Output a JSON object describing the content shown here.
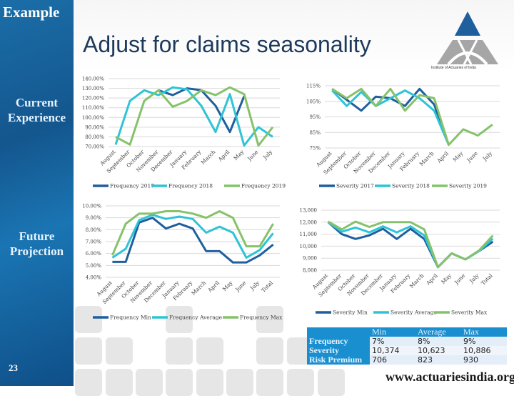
{
  "slide": {
    "tag": "Example",
    "title": "Adjust for claims seasonality",
    "section_current": [
      "Current",
      "Experience"
    ],
    "section_future": [
      "Future",
      "Projection"
    ],
    "page_number": "23",
    "logo_caption": "Institute of Actuaries of India",
    "website": "www.actuariesindia.org",
    "colors": {
      "dark_blue": "#1f5f9e",
      "teal": "#2ec4d6",
      "green": "#86c26a",
      "sidebar": "#14568e",
      "table_header": "#1a8fd0"
    }
  },
  "chart_data": [
    {
      "id": "frequency-current",
      "type": "line",
      "title": "",
      "categories": [
        "August",
        "September",
        "October",
        "November",
        "December",
        "January",
        "February",
        "March",
        "April",
        "May",
        "June",
        "July"
      ],
      "ylim": [
        70,
        140
      ],
      "yticks": [
        70,
        80,
        90,
        100,
        110,
        120,
        130,
        140
      ],
      "ytick_format": "pct2",
      "grid": true,
      "legend": "bottom",
      "series": [
        {
          "name": "Frequency 2017",
          "color": "#1f5f9e",
          "values": [
            null,
            null,
            null,
            128,
            123,
            130,
            128,
            112,
            85,
            122,
            null,
            null
          ]
        },
        {
          "name": "Frequency 2018",
          "color": "#2ec4d6",
          "values": [
            72,
            117,
            128,
            123,
            131,
            129,
            112,
            85,
            124,
            71,
            90,
            80
          ]
        },
        {
          "name": "Frequency 2019",
          "color": "#86c26a",
          "values": [
            80,
            72,
            117,
            128,
            111,
            117,
            128,
            123,
            131,
            124,
            71,
            90
          ]
        }
      ]
    },
    {
      "id": "severity-current",
      "type": "line",
      "title": "",
      "categories": [
        "August",
        "September",
        "October",
        "November",
        "December",
        "January",
        "February",
        "March",
        "April",
        "May",
        "June",
        "July"
      ],
      "ylim": [
        75,
        115
      ],
      "yticks": [
        75,
        85,
        95,
        105,
        115
      ],
      "ytick_format": "pct0",
      "grid": true,
      "legend": "bottom",
      "series": [
        {
          "name": "Severity 2017",
          "color": "#1f5f9e",
          "values": [
            113,
            106,
            99,
            108,
            107,
            102,
            113,
            103,
            77,
            null,
            null,
            null
          ]
        },
        {
          "name": "Severity 2018",
          "color": "#2ec4d6",
          "values": [
            112,
            102,
            111,
            102,
            107,
            112,
            107,
            99,
            77,
            null,
            null,
            null
          ]
        },
        {
          "name": "Severity 2019",
          "color": "#86c26a",
          "values": [
            113,
            107,
            113,
            102,
            113,
            99,
            109,
            107,
            77,
            87,
            83,
            90
          ]
        }
      ]
    },
    {
      "id": "frequency-projection",
      "type": "line",
      "title": "",
      "categories": [
        "August",
        "September",
        "October",
        "November",
        "December",
        "January",
        "February",
        "March",
        "April",
        "May",
        "June",
        "July",
        "Total"
      ],
      "ylim": [
        4,
        10
      ],
      "yticks": [
        4,
        5,
        6,
        7,
        8,
        9,
        10
      ],
      "ytick_format": "pct2",
      "grid": true,
      "legend": "bottom",
      "series": [
        {
          "name": "Frequency Min",
          "color": "#1f5f9e",
          "values": [
            5.3,
            5.3,
            8.6,
            9.0,
            8.1,
            8.5,
            8.1,
            6.2,
            6.2,
            5.25,
            5.25,
            5.85,
            6.75
          ]
        },
        {
          "name": "Frequency Average",
          "color": "#2ec4d6",
          "values": [
            5.65,
            6.4,
            8.8,
            9.25,
            8.9,
            9.1,
            8.9,
            7.75,
            8.25,
            7.75,
            5.65,
            6.3,
            7.7
          ]
        },
        {
          "name": "Frequency Max",
          "color": "#86c26a",
          "values": [
            5.85,
            8.5,
            9.35,
            9.35,
            9.55,
            9.55,
            9.35,
            9.0,
            9.55,
            9.0,
            6.6,
            6.6,
            8.5
          ]
        }
      ]
    },
    {
      "id": "severity-projection",
      "type": "line",
      "title": "",
      "categories": [
        "August",
        "September",
        "October",
        "November",
        "December",
        "January",
        "February",
        "March",
        "April",
        "May",
        "June",
        "July",
        "Total"
      ],
      "ylim": [
        8000,
        13000
      ],
      "yticks": [
        8000,
        9000,
        10000,
        11000,
        12000,
        13000
      ],
      "ytick_format": "num",
      "grid": true,
      "legend": "bottom",
      "series": [
        {
          "name": "Severity Min",
          "color": "#1f5f9e",
          "values": [
            12000,
            11000,
            10600,
            10900,
            11450,
            10600,
            11450,
            10600,
            8250,
            9400,
            8900,
            9600,
            10374
          ]
        },
        {
          "name": "Severity Average",
          "color": "#2ec4d6",
          "values": [
            12000,
            11200,
            11550,
            11150,
            11650,
            11150,
            11650,
            10900,
            8250,
            9400,
            8900,
            9600,
            10623
          ]
        },
        {
          "name": "Severity Max",
          "color": "#86c26a",
          "values": [
            12050,
            11400,
            12050,
            11600,
            12000,
            12000,
            12000,
            11400,
            8250,
            9400,
            8900,
            9650,
            10886
          ]
        }
      ]
    }
  ],
  "summary_table": {
    "columns": [
      "",
      "Min",
      "Average",
      "Max"
    ],
    "rows": [
      {
        "label": "Frequency",
        "values": [
          "7%",
          "8%",
          "9%"
        ]
      },
      {
        "label": "Severity",
        "values": [
          "10,374",
          "10,623",
          "10,886"
        ]
      },
      {
        "label": "Risk Premium",
        "values": [
          "706",
          "823",
          "930"
        ]
      }
    ]
  }
}
